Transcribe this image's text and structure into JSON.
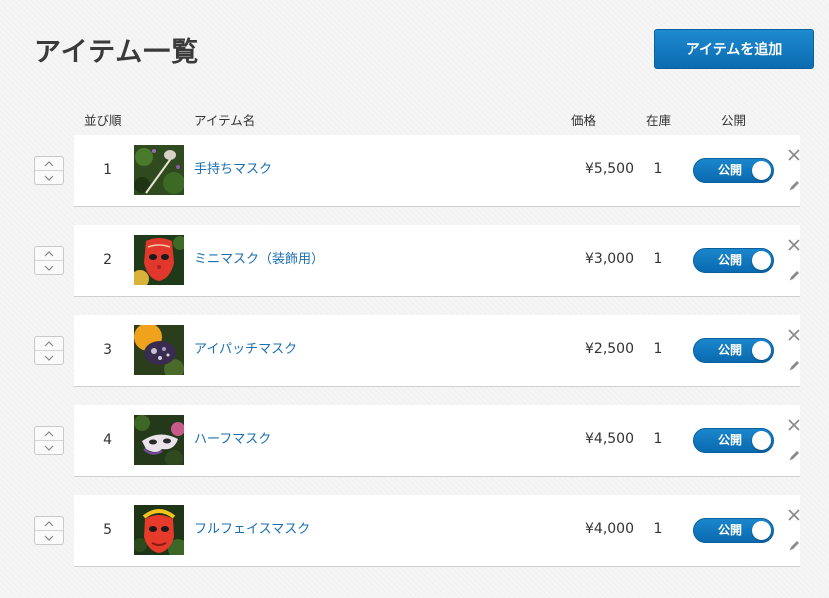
{
  "page": {
    "title": "アイテム一覧",
    "add_button_label": "アイテムを追加"
  },
  "columns": {
    "order": "並び順",
    "name": "アイテム名",
    "price": "価格",
    "stock": "在庫",
    "publish": "公開"
  },
  "items": [
    {
      "order": "1",
      "name": "手持ちマスク",
      "price": "¥5,500",
      "stock": "1",
      "status": "公開",
      "published": true,
      "thumb_icon": "hand-mask-photo"
    },
    {
      "order": "2",
      "name": "ミニマスク（装飾用）",
      "price": "¥3,000",
      "stock": "1",
      "status": "公開",
      "published": true,
      "thumb_icon": "mini-mask-photo"
    },
    {
      "order": "3",
      "name": "アイパッチマスク",
      "price": "¥2,500",
      "stock": "1",
      "status": "公開",
      "published": true,
      "thumb_icon": "eyepatch-mask-photo"
    },
    {
      "order": "4",
      "name": "ハーフマスク",
      "price": "¥4,500",
      "stock": "1",
      "status": "公開",
      "published": true,
      "thumb_icon": "half-mask-photo"
    },
    {
      "order": "5",
      "name": "フルフェイスマスク",
      "price": "¥4,000",
      "stock": "1",
      "status": "公開",
      "published": true,
      "thumb_icon": "full-face-mask-photo"
    }
  ],
  "icons": {
    "sort_up": "chevron-up-icon",
    "sort_down": "chevron-down-icon",
    "delete": "close-icon",
    "edit": "pencil-icon"
  },
  "colors": {
    "accent": "#0b72b9",
    "link": "#1a6fb0",
    "background": "#f5f5f5",
    "card": "#ffffff"
  }
}
